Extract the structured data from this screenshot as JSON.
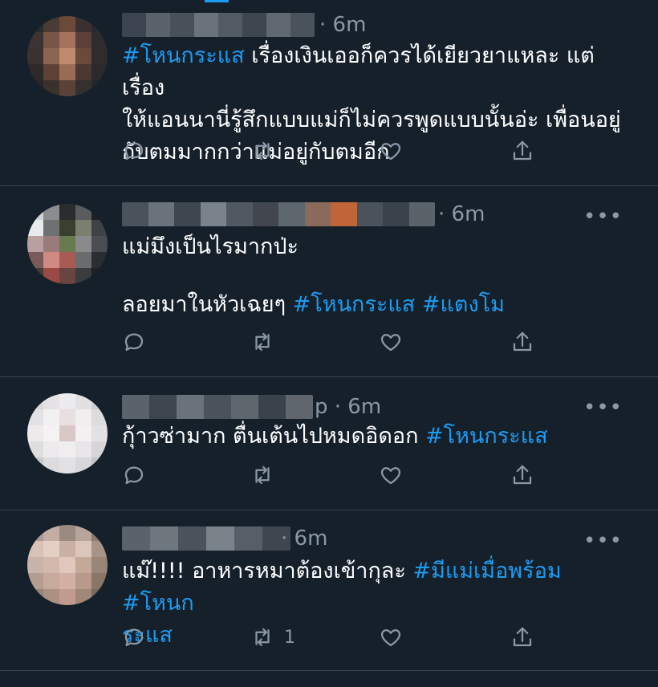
{
  "tweets": [
    {
      "time": "· 6m",
      "lines": [
        [
          {
            "t": "#โหนกระแส",
            "tag": true
          },
          {
            "t": " เรื่องเงินเออก็ควรได้เยียวยาแหละ แต่เรื่อง",
            "tag": false
          }
        ],
        [
          {
            "t": "ให้แอนนานี่รู้สึกแบบแม่ก็ไม่ควรพูดแบบนั้นอ่ะ เพื่อนอยู่",
            "tag": false
          }
        ],
        [
          {
            "t": "กับตมมากกว่าแม่อยู่กับตมอีก",
            "tag": false
          }
        ]
      ],
      "retweet_count": ""
    },
    {
      "time": "· 6m",
      "more": "•••",
      "lines": [
        [
          {
            "t": "แม่มึงเป็นไรมากป่ะ",
            "tag": false
          }
        ],
        [],
        [
          {
            "t": "ลอยมาในหัวเฉยๆ ",
            "tag": false
          },
          {
            "t": "#โหนกระแส",
            "tag": true
          },
          {
            "t": " ",
            "tag": false
          },
          {
            "t": "#แตงโม",
            "tag": true
          }
        ]
      ],
      "retweet_count": ""
    },
    {
      "time": "p · 6m",
      "more": "•••",
      "lines": [
        [
          {
            "t": "กุ้าวซ่ามาก ตื่นเต้นไปหมดอิดอก ",
            "tag": false
          },
          {
            "t": "#โหนกระแส",
            "tag": true
          }
        ]
      ],
      "retweet_count": ""
    },
    {
      "time": "· 6m",
      "more": "•••",
      "lines": [
        [
          {
            "t": "แม๊!!!! อาหารหมาต้องเข้ากุละ ",
            "tag": false
          },
          {
            "t": "#มีแม่เมื่อพร้อม",
            "tag": true
          },
          {
            "t": " ",
            "tag": false
          },
          {
            "t": "#โหนก",
            "tag": true
          }
        ],
        [
          {
            "t": "ระแส",
            "tag": true
          }
        ]
      ],
      "retweet_count": "1"
    }
  ],
  "icons": {
    "reply": "reply-icon",
    "retweet": "retweet-icon",
    "like": "like-icon",
    "share": "share-icon",
    "more": "more-icon"
  },
  "colors": {
    "background": "#15202b",
    "hashtag": "#1d9bf0",
    "secondary": "#8b98a5",
    "divider": "#38444d"
  }
}
